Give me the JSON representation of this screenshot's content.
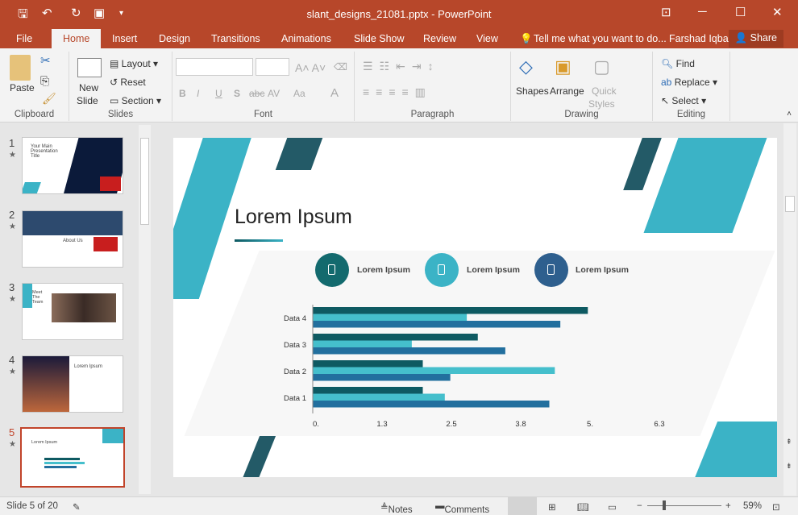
{
  "window": {
    "title": "slant_designs_21081.pptx - PowerPoint"
  },
  "tabs": [
    {
      "label": "File"
    },
    {
      "label": "Home"
    },
    {
      "label": "Insert"
    },
    {
      "label": "Design"
    },
    {
      "label": "Transitions"
    },
    {
      "label": "Animations"
    },
    {
      "label": "Slide Show"
    },
    {
      "label": "Review"
    },
    {
      "label": "View"
    }
  ],
  "tell_me": "Tell me what you want to do...",
  "user": "Farshad Iqbal",
  "share": "Share",
  "ribbon": {
    "clipboard": {
      "label": "Clipboard",
      "paste": "Paste"
    },
    "slides": {
      "label": "Slides",
      "new_slide_1": "New",
      "new_slide_2": "Slide",
      "layout": "Layout",
      "reset": "Reset",
      "section": "Section"
    },
    "font": {
      "label": "Font",
      "bold": "B",
      "italic": "I",
      "underline": "U",
      "shadow": "S",
      "strike": "abc",
      "spacing": "AV",
      "case": "Aa",
      "color": "A"
    },
    "paragraph": {
      "label": "Paragraph"
    },
    "drawing": {
      "label": "Drawing",
      "shapes": "Shapes",
      "arrange": "Arrange",
      "quick_styles_1": "Quick",
      "quick_styles_2": "Styles"
    },
    "editing": {
      "label": "Editing",
      "find": "Find",
      "replace": "Replace",
      "select": "Select"
    }
  },
  "thumbnails": [
    {
      "num": "1",
      "title": "Your Main Presentation Title"
    },
    {
      "num": "2",
      "title": "About Us"
    },
    {
      "num": "3",
      "title": "Meet The Team"
    },
    {
      "num": "4",
      "title": "Lorem Ipsum"
    },
    {
      "num": "5",
      "title": "Lorem Ipsum"
    }
  ],
  "slide": {
    "title": "Lorem Ipsum",
    "icons": [
      {
        "label": "Lorem Ipsum",
        "color": "#136a6e"
      },
      {
        "label": "Lorem Ipsum",
        "color": "#3bb3c6"
      },
      {
        "label": "Lorem Ipsum",
        "color": "#2e5f8e"
      }
    ]
  },
  "chart_data": {
    "type": "bar",
    "orientation": "horizontal",
    "categories": [
      "Data 1",
      "Data 2",
      "Data 3",
      "Data 4"
    ],
    "series": [
      {
        "color": "#0e5a62",
        "values": [
          2.0,
          2.0,
          3.0,
          5.0
        ]
      },
      {
        "color": "#45bfcc",
        "values": [
          2.4,
          4.4,
          1.8,
          2.8
        ]
      },
      {
        "color": "#226f9e",
        "values": [
          4.3,
          2.5,
          3.5,
          4.5
        ]
      }
    ],
    "xlim": [
      0,
      6.3
    ],
    "xticks": [
      "0.",
      "1.3",
      "2.5",
      "3.8",
      "5.",
      "6.3"
    ],
    "grid": false
  },
  "status": {
    "slide": "Slide 5 of 20",
    "notes": "Notes",
    "comments": "Comments",
    "zoom": "59%"
  },
  "accent": "#b7472a"
}
